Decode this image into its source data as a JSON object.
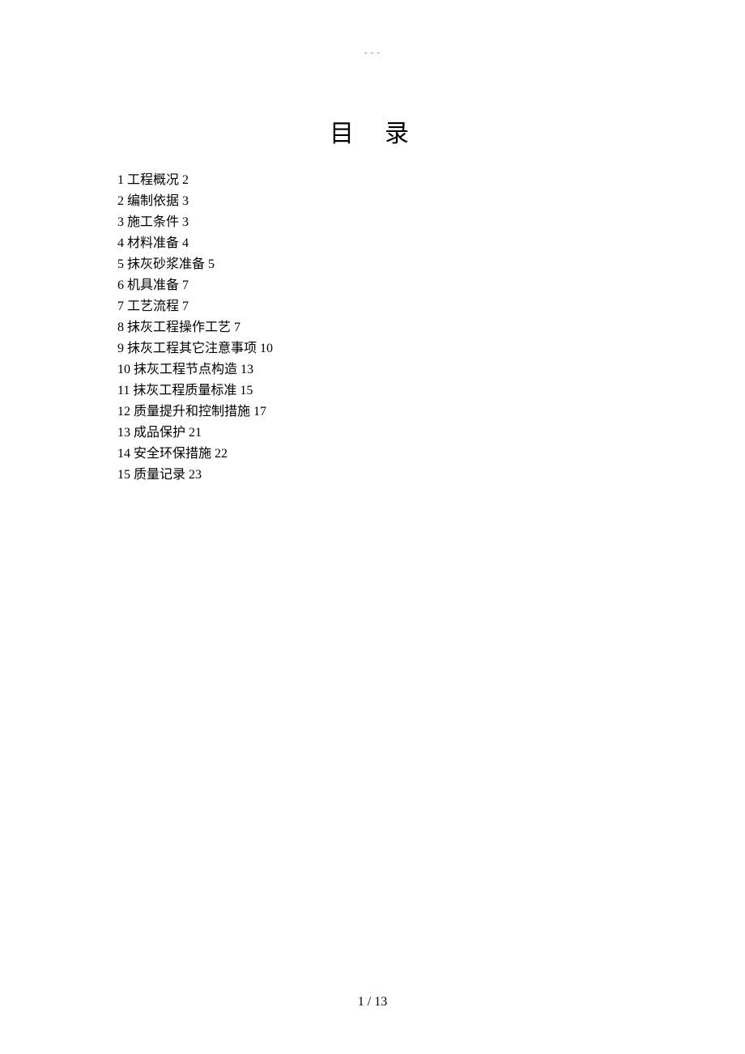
{
  "header_mark": "- - -",
  "title_char1": "目",
  "title_char2": "录",
  "toc": [
    {
      "num": "1",
      "text": "工程概况",
      "page": "2"
    },
    {
      "num": "2",
      "text": "编制依据",
      "page": "3"
    },
    {
      "num": "3",
      "text": "施工条件",
      "page": "3"
    },
    {
      "num": "4",
      "text": "材料准备",
      "page": "4"
    },
    {
      "num": "5",
      "text": "抹灰砂浆准备",
      "page": "5"
    },
    {
      "num": "6",
      "text": "机具准备",
      "page": "7"
    },
    {
      "num": "7",
      "text": "工艺流程",
      "page": "7"
    },
    {
      "num": "8",
      "text": "抹灰工程操作工艺",
      "page": "7"
    },
    {
      "num": "9",
      "text": "抹灰工程其它注意事项",
      "page": "10"
    },
    {
      "num": "10",
      "text": "抹灰工程节点构造",
      "page": "13"
    },
    {
      "num": "11",
      "text": "抹灰工程质量标准",
      "page": "15"
    },
    {
      "num": "12",
      "text": "质量提升和控制措施",
      "page": "17"
    },
    {
      "num": "13",
      "text": "成品保护",
      "page": "21"
    },
    {
      "num": "14",
      "text": "安全环保措施",
      "page": "22"
    },
    {
      "num": "15",
      "text": "质量记录",
      "page": "23"
    }
  ],
  "footer": "1 / 13"
}
